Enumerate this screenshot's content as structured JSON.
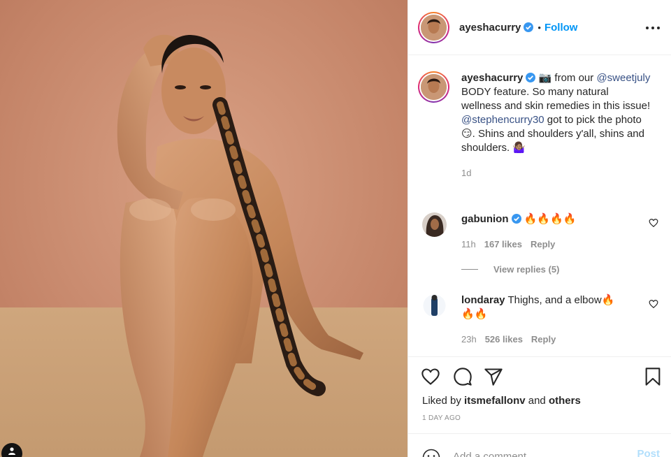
{
  "post": {
    "username": "ayeshacurry",
    "follow_label": "Follow",
    "separator": "•"
  },
  "caption": {
    "username": "ayeshacurry",
    "part1": "📷 from our ",
    "mention1": "@sweetjuly",
    "part2": " BODY feature. So many natural wellness and skin remedies in this issue! ",
    "mention2": "@stephencurry30",
    "part3": " got to pick the photo😏. Shins and shoulders y'all, shins and shoulders. 🤷🏽‍♀️",
    "age": "1d"
  },
  "comments": [
    {
      "username": "gabunion",
      "text": "🔥🔥🔥🔥",
      "time": "11h",
      "likes": "167 likes",
      "reply": "Reply",
      "view_replies": "View replies (5)"
    },
    {
      "username": "londaray",
      "text": "Thighs, and a elbow🔥🔥🔥",
      "time": "23h",
      "likes": "526 likes",
      "reply": "Reply"
    }
  ],
  "likes": {
    "prefix": "Liked by ",
    "user": "itsmefallonv",
    "and": " and ",
    "others": "others"
  },
  "timestamp": "1 DAY AGO",
  "add_comment": {
    "placeholder": "Add a comment…",
    "post_label": "Post"
  },
  "icons": [
    "verified-badge-icon",
    "more-options-icon",
    "heart-icon",
    "comment-icon",
    "share-icon",
    "bookmark-icon",
    "emoji-icon",
    "user-tag-icon"
  ],
  "colors": {
    "accent": "#0095f6",
    "mention": "#385185",
    "muted": "#8e8e8e",
    "post_disabled": "#b2dffc",
    "photo_backdrop": "#c98e72"
  }
}
